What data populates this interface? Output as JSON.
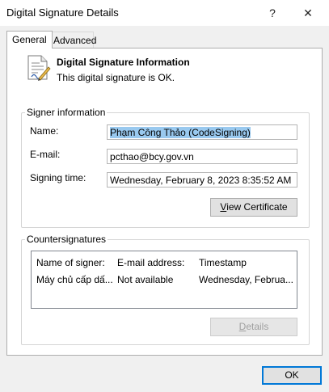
{
  "window": {
    "title": "Digital Signature Details",
    "help_glyph": "?",
    "close_glyph": "✕"
  },
  "tabs": [
    {
      "label": "General",
      "active": true
    },
    {
      "label": "Advanced",
      "active": false
    }
  ],
  "info": {
    "heading": "Digital Signature Information",
    "status": "This digital signature is OK.",
    "icon": "signed-document-icon"
  },
  "signer": {
    "group_label": "Signer information",
    "name_label": "Name:",
    "name_value": "Phạm Công Thảo (CodeSigning)",
    "email_label": "E-mail:",
    "email_value": "pcthao@bcy.gov.vn",
    "time_label": "Signing time:",
    "time_value": "Wednesday, February 8, 2023 8:35:52 AM",
    "view_cert_label_underlined": "V",
    "view_cert_label_rest": "iew Certificate"
  },
  "countersignatures": {
    "group_label": "Countersignatures",
    "columns": [
      "Name of signer:",
      "E-mail address:",
      "Timestamp"
    ],
    "rows": [
      [
        "Máy chủ cấp dấ...",
        "Not available",
        "Wednesday, Februa..."
      ]
    ],
    "details_label_underlined": "D",
    "details_label_rest": "etails"
  },
  "footer": {
    "ok_label": "OK"
  },
  "colors": {
    "accent": "#0078d7",
    "selection": "#99c9ef"
  }
}
